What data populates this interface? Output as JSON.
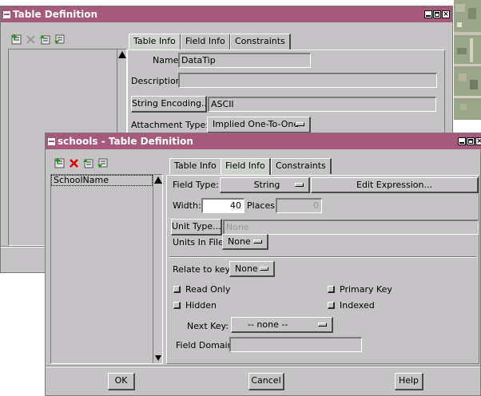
{
  "back_window": {
    "title": "Table Definition",
    "tabs": [
      "Table Info",
      "Field Info",
      "Constraints"
    ],
    "name_label": "Name:",
    "name_value": "DataTip",
    "description_label": "Description:",
    "description_value": "",
    "string_encoding_button": "String Encoding...",
    "string_encoding_value": "ASCII",
    "attachment_type_label": "Attachment Type:",
    "attachment_type_value": "Implied One-To-One"
  },
  "front_window": {
    "title": "schools - Table Definition",
    "tabs": [
      "Table Info",
      "Field Info",
      "Constraints"
    ],
    "field_list": [
      "SchoolName"
    ],
    "field_type_label": "Field Type:",
    "field_type_value": "String",
    "edit_expression_button": "Edit Expression...",
    "width_label": "Width:",
    "width_value": "40",
    "places_label": "Places:",
    "places_value": "0",
    "unit_type_button": "Unit Type...",
    "unit_type_value": "None",
    "units_in_file_label": "Units In File:",
    "units_in_file_value": "None",
    "relate_to_key_label": "Relate to key:",
    "relate_to_key_value": "None",
    "read_only_label": "Read Only",
    "primary_key_label": "Primary Key",
    "hidden_label": "Hidden",
    "indexed_label": "Indexed",
    "next_key_label": "Next Key:",
    "next_key_value": "-- none --",
    "field_domain_label": "Field Domain:",
    "field_domain_value": "",
    "ok_button": "OK",
    "cancel_button": "Cancel",
    "help_button": "Help"
  },
  "colors": {
    "titlebar": "#a5597b",
    "panel": "#c6c3c6",
    "delete_icon": "#e00000"
  }
}
